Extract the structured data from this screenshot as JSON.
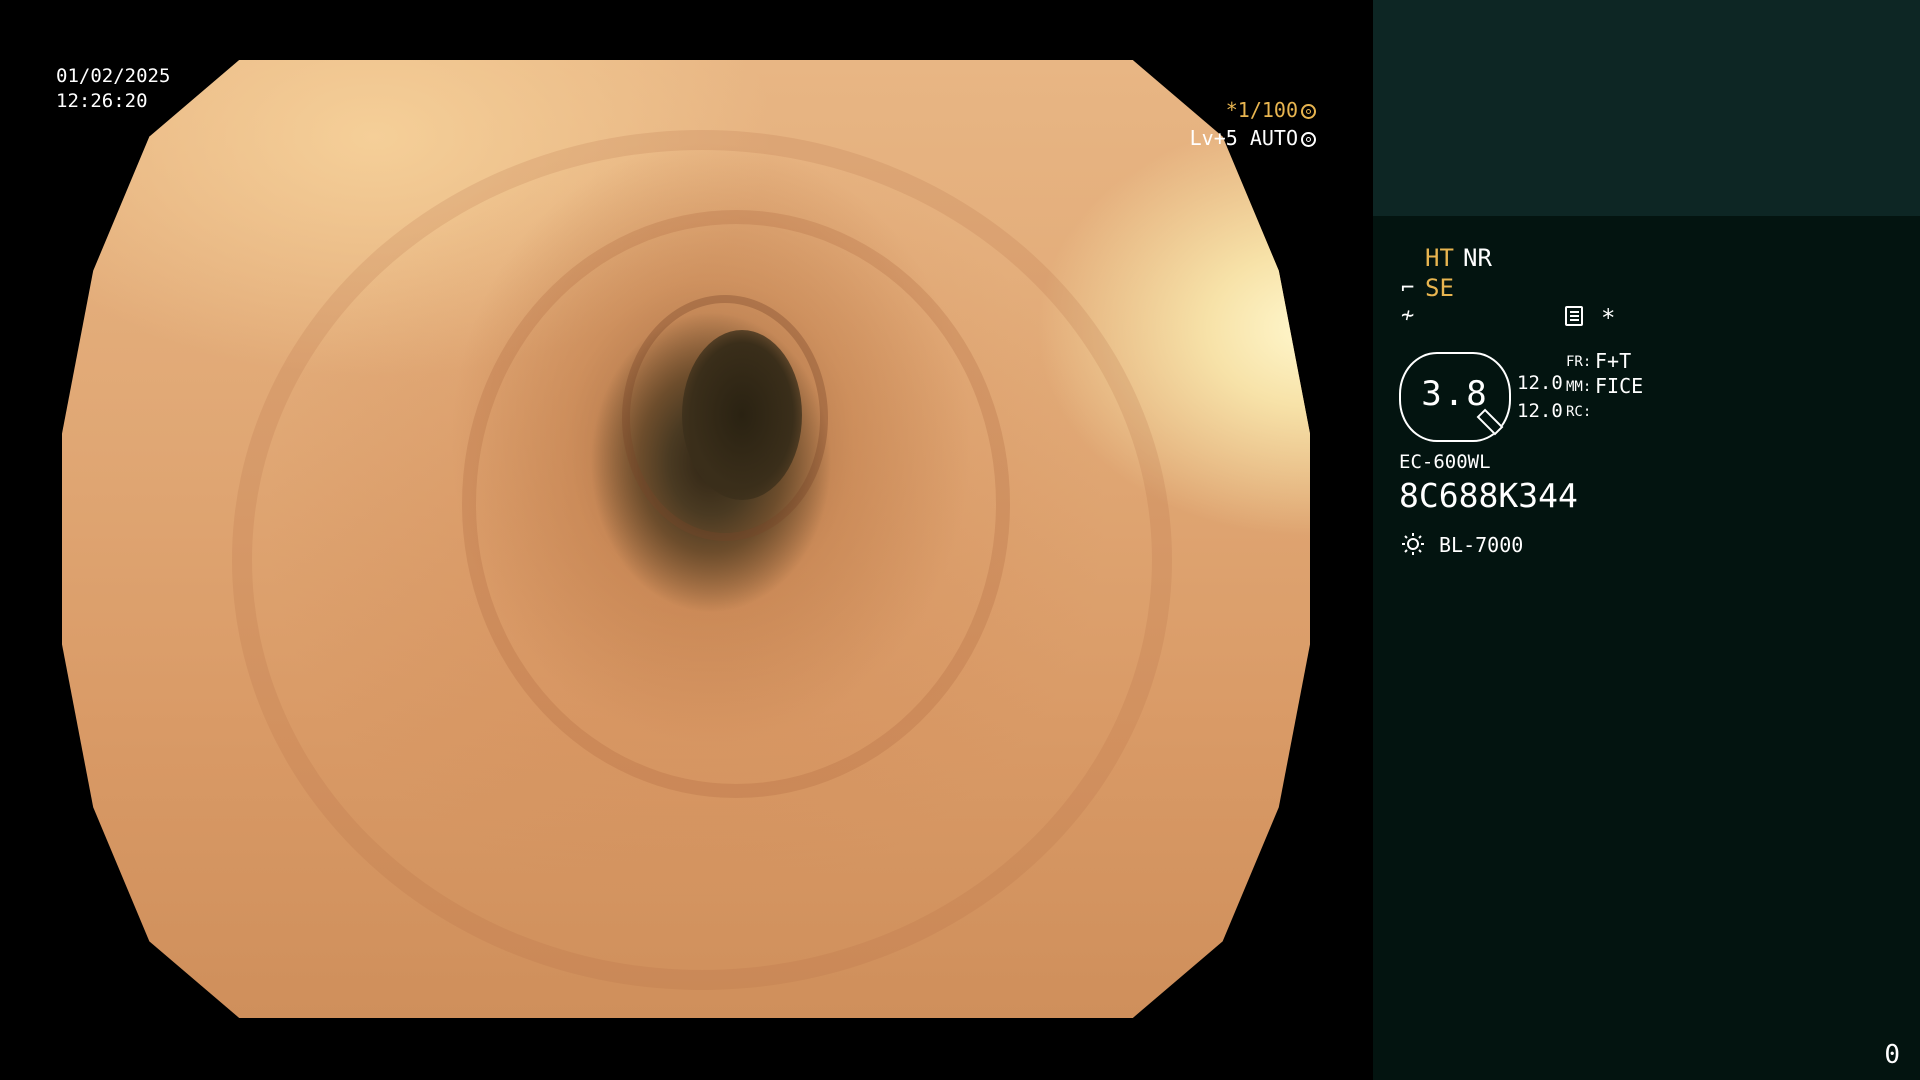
{
  "datetime": {
    "date": "01/02/2025",
    "time": "12:26:20"
  },
  "top_indicators": {
    "shutter": "*1/100",
    "level": "Lv+5 AUTO"
  },
  "panel": {
    "ht_label": "HT",
    "nr_label": "NR",
    "se_label": "SE",
    "star": "*",
    "iris_value": "3.8",
    "value_1": "12.0",
    "value_2": "12.0",
    "fr_label": "FR:",
    "mm_label": "MM:",
    "rc_label": "RC:",
    "fr_value": "F+T",
    "mm_value": "FICE",
    "scope_model": "EC-600WL",
    "scope_serial": "8C688K344",
    "light_source": "BL-7000"
  },
  "counter": "0",
  "colors": {
    "accent_gold": "#e8b550",
    "panel_bg": "#031410",
    "panel_top_bg": "#0d2624"
  },
  "icons": [
    "aperture-icon",
    "auto-ring-icon",
    "tilde-hook-icon",
    "fne-icon",
    "menu-icon",
    "iris-icon",
    "sun-icon"
  ]
}
